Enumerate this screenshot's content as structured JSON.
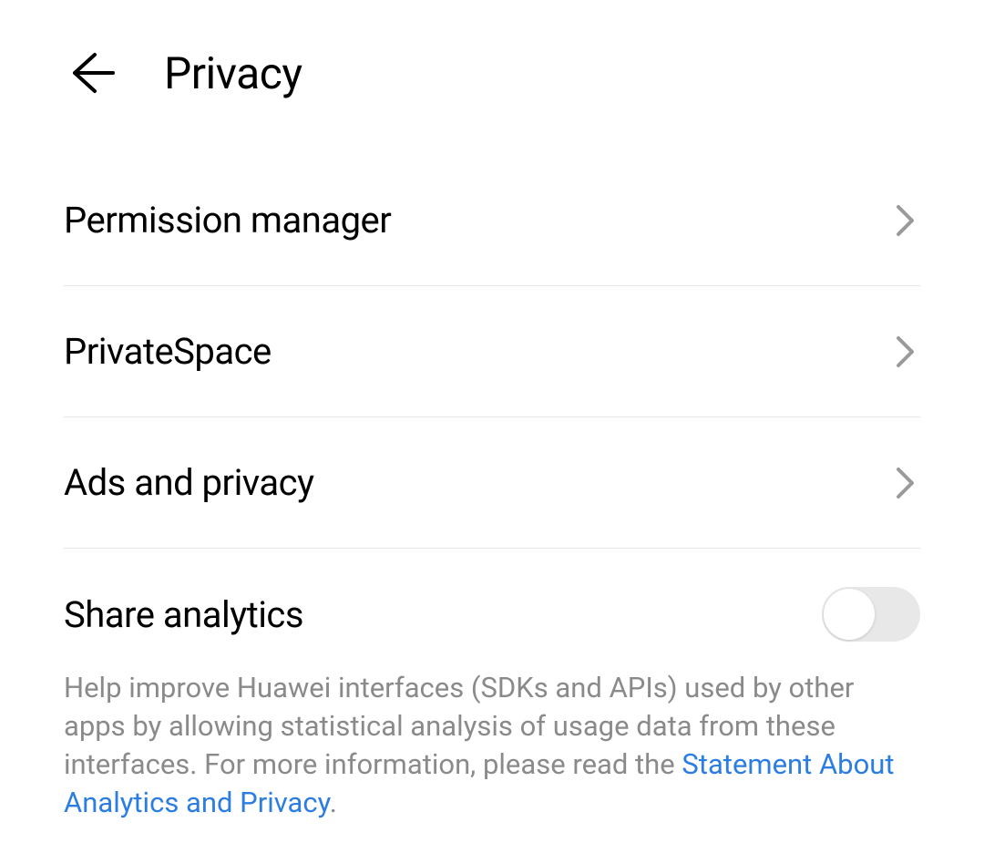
{
  "header": {
    "title": "Privacy"
  },
  "settings": {
    "permission_manager": {
      "label": "Permission manager"
    },
    "private_space": {
      "label": "PrivateSpace"
    },
    "ads_privacy": {
      "label": "Ads and privacy"
    },
    "share_analytics": {
      "label": "Share analytics",
      "enabled": false
    }
  },
  "help_text": {
    "body": "Help improve Huawei interfaces (SDKs and APIs) used by other apps by allowing statistical analysis of usage data from these interfaces. For more information, please read the ",
    "link_text": "Statement About Analytics and Privacy",
    "suffix": "."
  }
}
